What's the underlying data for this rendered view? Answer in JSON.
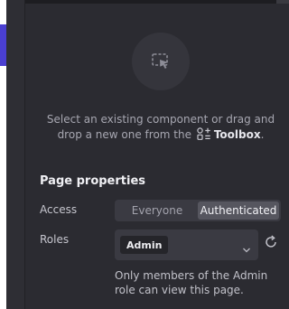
{
  "panel": {
    "empty_state": {
      "icon": "cursor-select-icon",
      "message_prefix": "Select an existing component or drag and drop a new one from the",
      "toolbox_icon": "toolbox-icon",
      "toolbox_label": "Toolbox",
      "message_suffix": "."
    },
    "page_properties": {
      "title": "Page properties",
      "access": {
        "label": "Access",
        "options": [
          "Everyone",
          "Authenticated"
        ],
        "selected": "Authenticated"
      },
      "roles": {
        "label": "Roles",
        "selected_chip": "Admin",
        "dropdown_icon": "chevron-down-icon",
        "reset_icon": "refresh-icon",
        "help_text": "Only members of the Admin role can view this page."
      }
    }
  },
  "colors": {
    "panel_bg": "#2b2b31",
    "canvas_accent": "#4a3fd1",
    "active_segment": "#56565f"
  }
}
